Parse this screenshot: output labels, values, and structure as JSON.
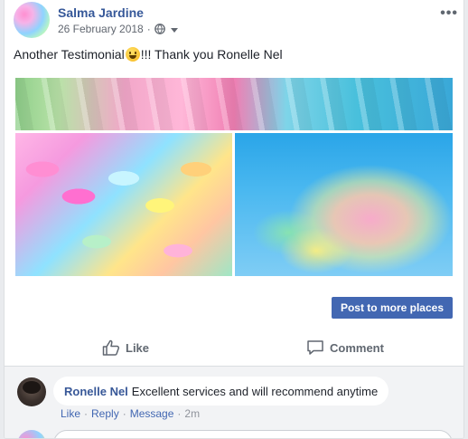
{
  "post": {
    "author": "Salma Jardine",
    "date": "26 February 2018",
    "privacy_icon": "globe-icon",
    "text_before": "Another Testimonial ",
    "text_after": "!!! Thank you Ronelle Nel",
    "emoji": "grinning-face-icon",
    "more_icon": "more-options-icon",
    "more_label": "•••"
  },
  "photos": [
    "cotton-candy-strip",
    "cotton-candy-bundles",
    "cotton-candy-bouquet"
  ],
  "actions": {
    "post_more_label": "Post to more places",
    "like_label": "Like",
    "comment_label": "Comment"
  },
  "comments": [
    {
      "author": "Ronelle Nel",
      "text": "Excellent services and will recommend anytime",
      "like": "Like",
      "reply": "Reply",
      "message": "Message",
      "time": "2m",
      "sep": "·"
    }
  ],
  "colors": {
    "link": "#365899",
    "primary_button": "#4267b2",
    "muted": "#606770"
  }
}
